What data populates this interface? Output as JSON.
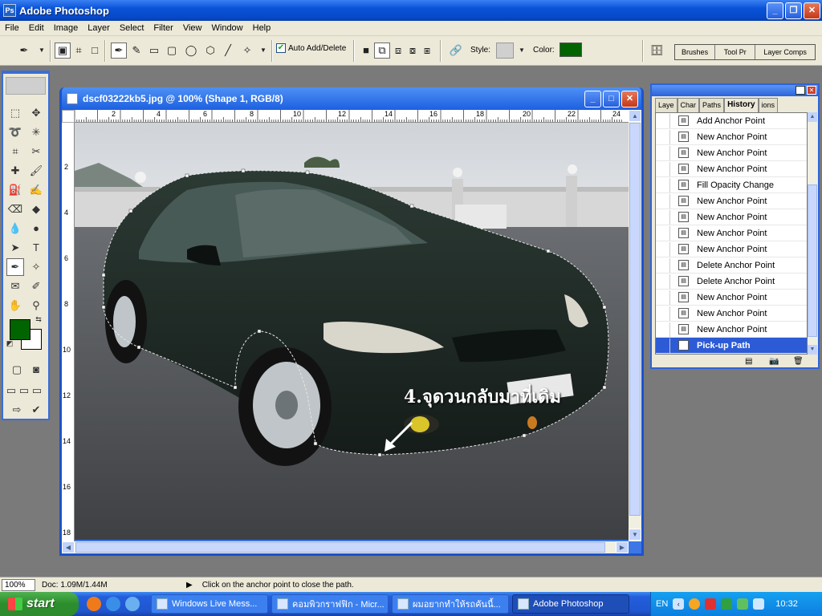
{
  "app": {
    "title": "Adobe Photoshop"
  },
  "menu": {
    "items": [
      "File",
      "Edit",
      "Image",
      "Layer",
      "Select",
      "Filter",
      "View",
      "Window",
      "Help"
    ]
  },
  "options": {
    "auto_add_label": "Auto Add/Delete",
    "style_label": "Style:",
    "color_label": "Color:",
    "shape_color": "#006400",
    "palette_wells": [
      "Brushes",
      "Tool Pr",
      "Layer Comps"
    ]
  },
  "document": {
    "title": "dscf03222kb5.jpg @ 100% (Shape 1, RGB/8)",
    "ruler_h": [
      "2",
      "4",
      "6",
      "8",
      "10",
      "12",
      "14",
      "16",
      "18",
      "20",
      "22",
      "24"
    ],
    "ruler_v": [
      "2",
      "4",
      "6",
      "8",
      "10",
      "12",
      "14",
      "16",
      "18"
    ],
    "annotation": "4.จุดวนกลับมาที่เดิม"
  },
  "history": {
    "tabs": [
      "Laye",
      "Char",
      "Paths",
      "History",
      "ions"
    ],
    "items": [
      "Add Anchor Point",
      "New Anchor Point",
      "New Anchor Point",
      "New Anchor Point",
      "Fill Opacity Change",
      "New Anchor Point",
      "New Anchor Point",
      "New Anchor Point",
      "New Anchor Point",
      "Delete Anchor Point",
      "Delete Anchor Point",
      "New Anchor Point",
      "New Anchor Point",
      "New Anchor Point",
      "Pick-up Path"
    ]
  },
  "status": {
    "zoom": "100%",
    "doc": "Doc: 1.09M/1.44M",
    "hint": "Click on the anchor point to close the path."
  },
  "taskbar": {
    "start": "start",
    "tasks": [
      "Windows Live Mess...",
      "คอมพิวกราฟฟิก - Micr...",
      "ผมอยากทำให้รถคันนี้...",
      "Adobe Photoshop"
    ],
    "lang": "EN",
    "clock": "10:32"
  }
}
